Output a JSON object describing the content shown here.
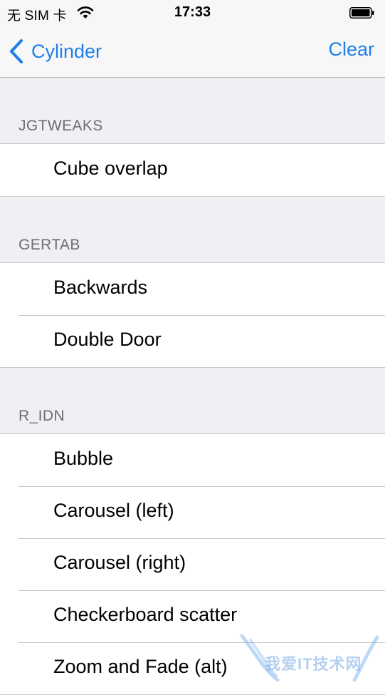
{
  "status_bar": {
    "carrier": "无 SIM 卡",
    "time": "17:33",
    "icons": [
      "wifi-icon",
      "battery-icon"
    ]
  },
  "nav_bar": {
    "back_label": "Cylinder",
    "back_icon": "chevron-left-icon",
    "right_action": "Clear",
    "accent_color": "#1f7fe8"
  },
  "sections": [
    {
      "header": "JGTWEAKS",
      "items": [
        "Cube overlap"
      ]
    },
    {
      "header": "GERTAB",
      "items": [
        "Backwards",
        "Double Door"
      ]
    },
    {
      "header": "R_IDN",
      "items": [
        "Bubble",
        "Carousel (left)",
        "Carousel (right)",
        "Checkerboard scatter",
        "Zoom and Fade (alt)"
      ]
    }
  ],
  "watermark": {
    "text": "我爱IT技术网"
  }
}
